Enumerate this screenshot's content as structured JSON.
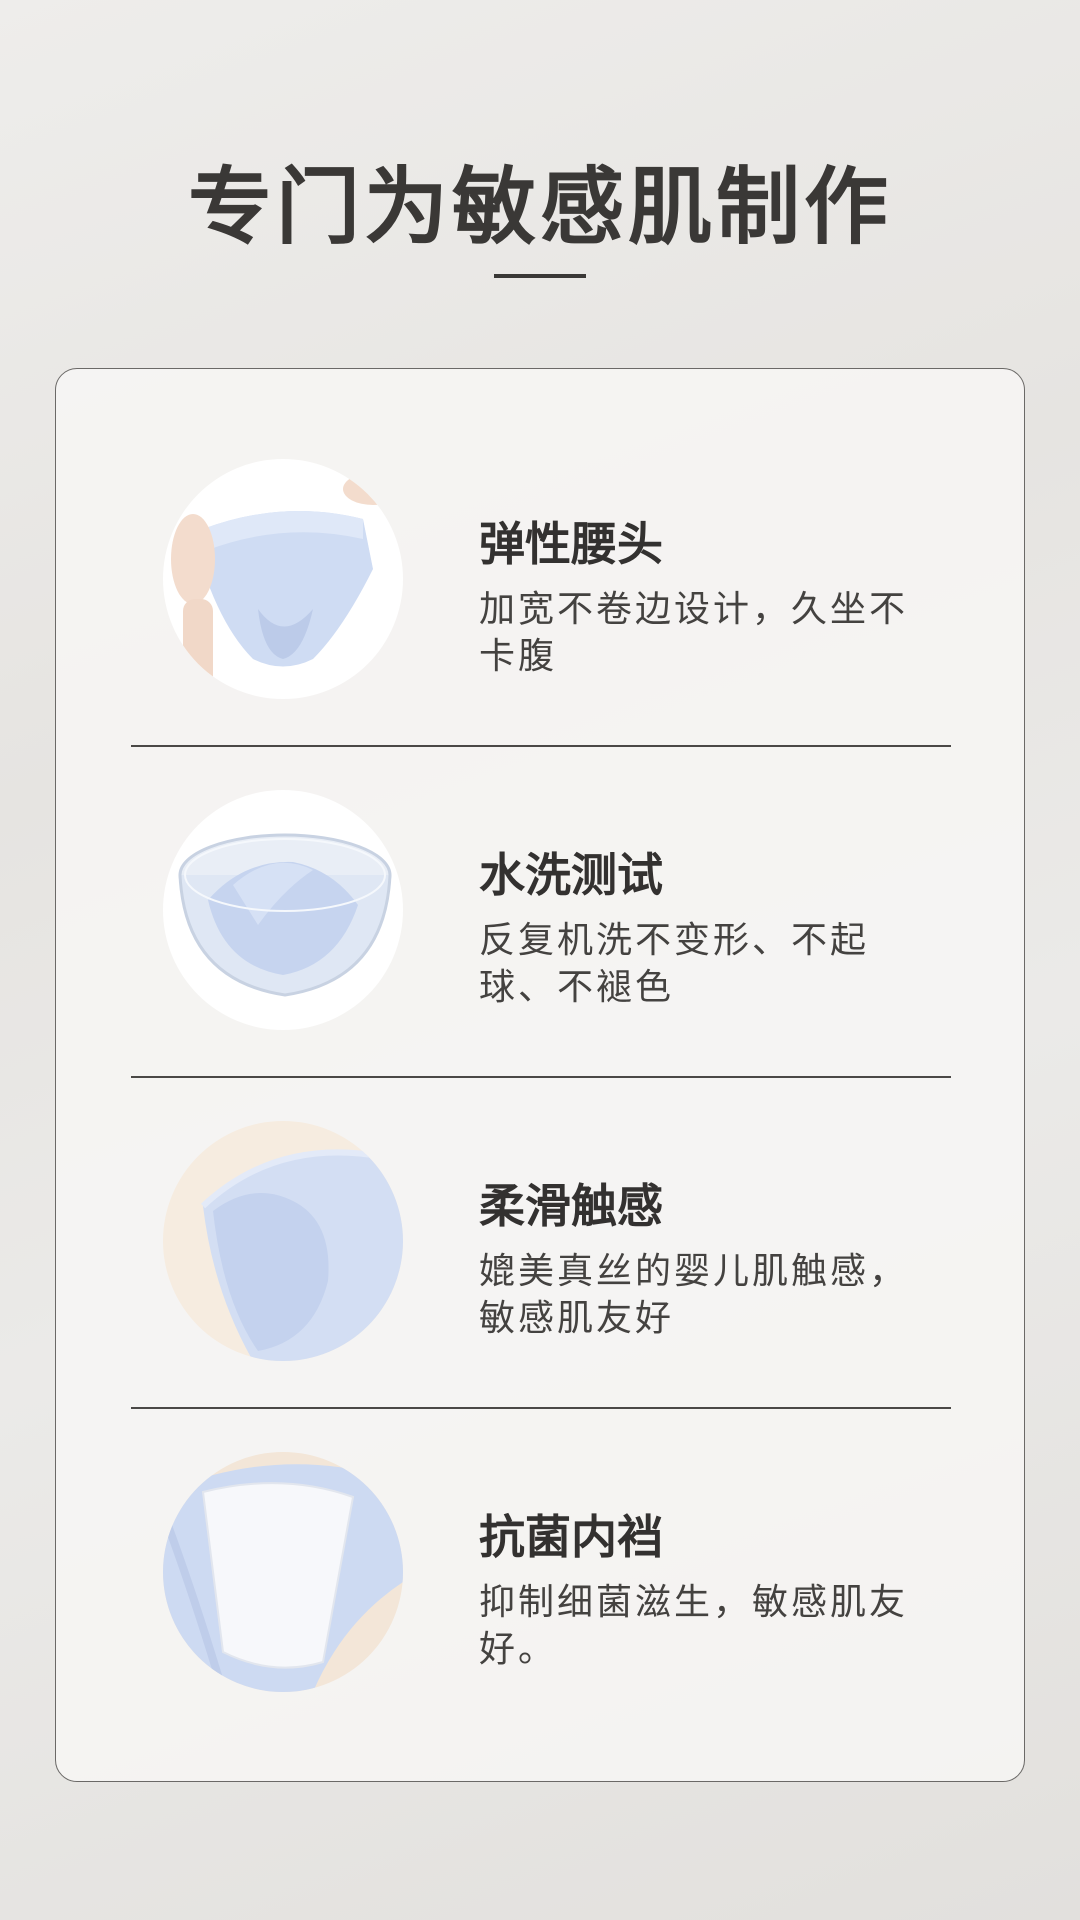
{
  "page": {
    "title": "专门为敏感肌制作"
  },
  "features": [
    {
      "title": "弹性腰头",
      "description": "加宽不卷边设计，久坐不卡腹"
    },
    {
      "title": "水洗测试",
      "description": "反复机洗不变形、不起球、不褪色"
    },
    {
      "title": "柔滑触感",
      "description": "媲美真丝的婴儿肌触感，敏感肌友好"
    },
    {
      "title": "抗菌内裆",
      "description": "抑制细菌滋生，敏感肌友好。"
    }
  ],
  "colors": {
    "text_dark": "#333130",
    "fabric_blue": "#c9d6f0",
    "background": "#eeedeb"
  },
  "icons": {
    "feature_images": [
      "waistband-photo",
      "wash-test-photo",
      "soft-fabric-photo",
      "antibacterial-gusset-photo"
    ]
  }
}
